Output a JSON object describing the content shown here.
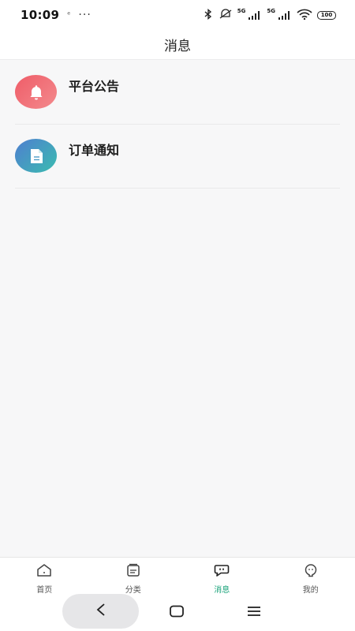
{
  "status_bar": {
    "time": "10:09",
    "small_indicator": "ᵉ",
    "dots": "···",
    "sig1_label": "5G",
    "sig2_label": "5G",
    "battery": "100"
  },
  "header": {
    "title": "消息"
  },
  "messages": [
    {
      "title": "平台公告",
      "icon": "bell-icon",
      "color": "#ef5c68"
    },
    {
      "title": "订单通知",
      "icon": "document-icon",
      "color": "#4f7ed0"
    }
  ],
  "tabs": [
    {
      "label": "首页",
      "icon": "home-icon",
      "active": false
    },
    {
      "label": "分类",
      "icon": "category-icon",
      "active": false
    },
    {
      "label": "消息",
      "icon": "message-icon",
      "active": true
    },
    {
      "label": "我的",
      "icon": "profile-icon",
      "active": false
    }
  ],
  "colors": {
    "accent": "#1aa37a"
  }
}
